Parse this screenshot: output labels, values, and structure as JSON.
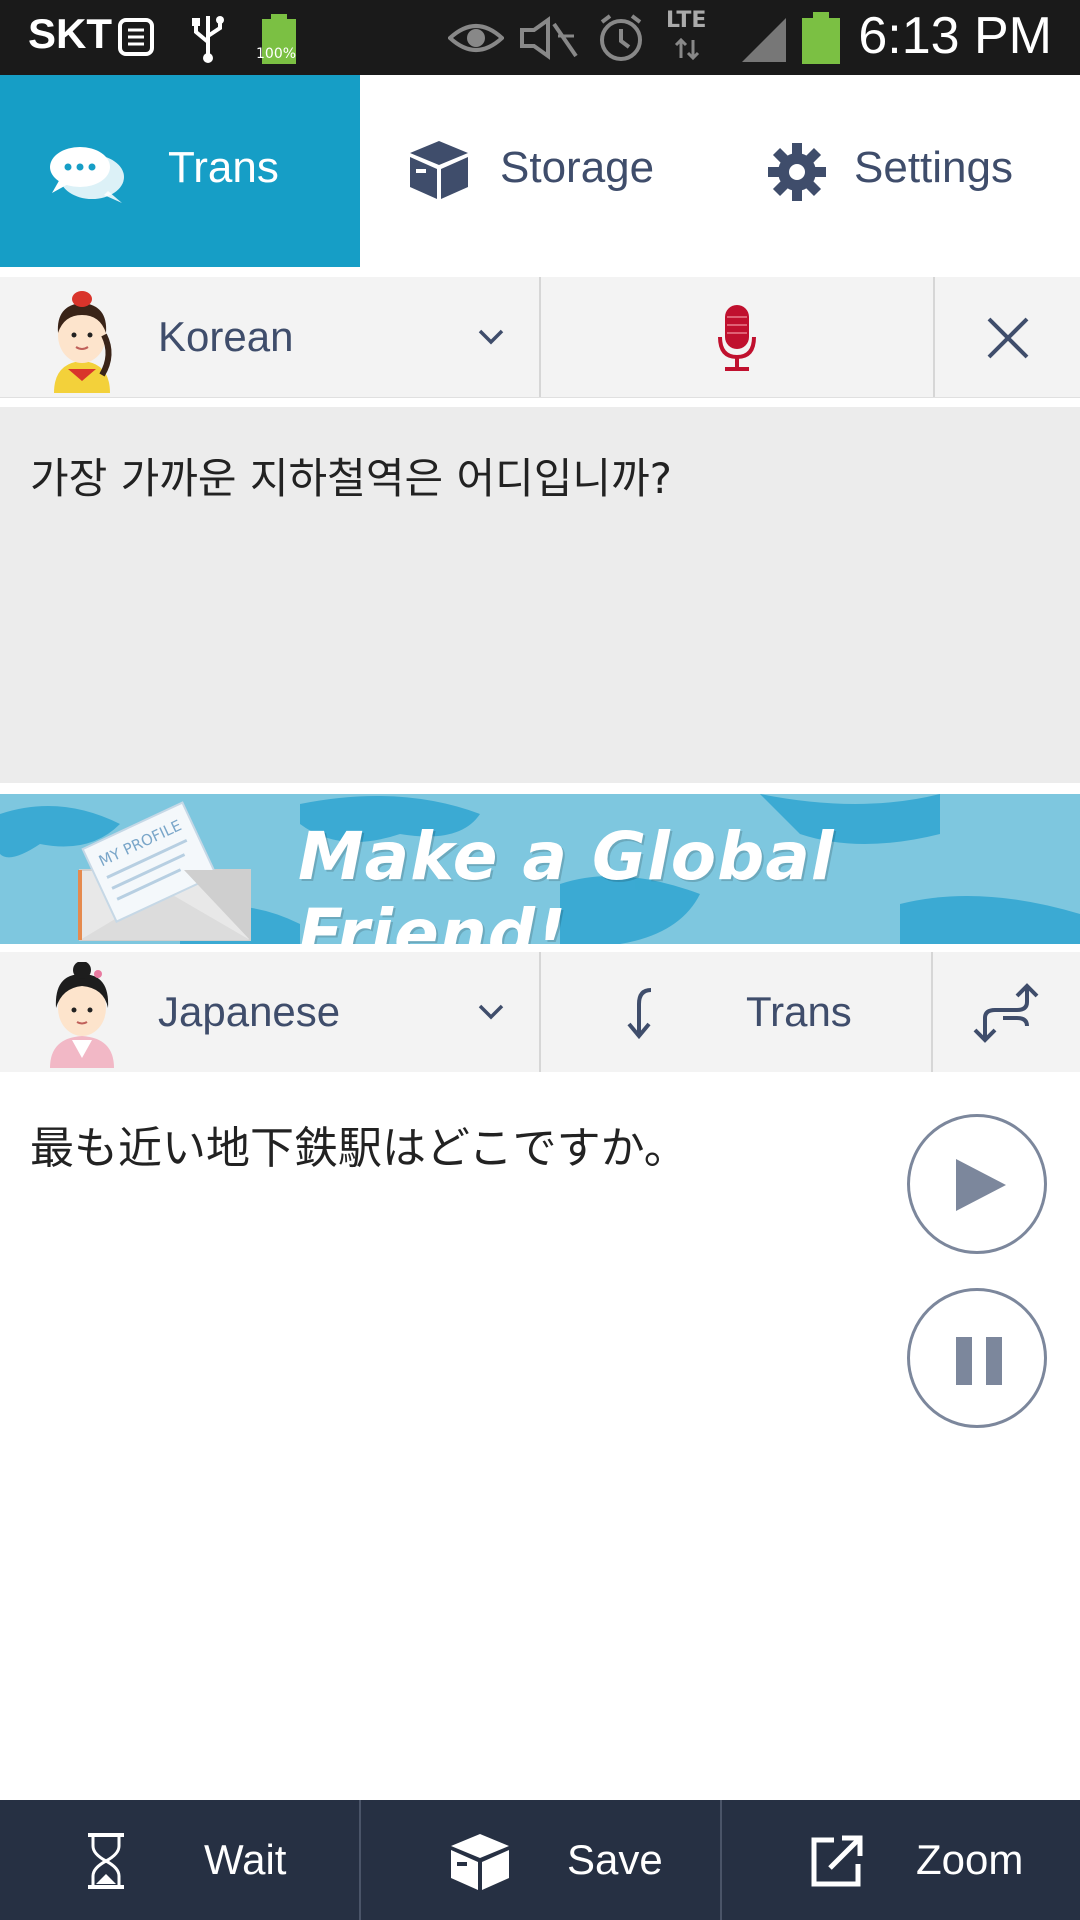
{
  "status_bar": {
    "carrier": "SKT",
    "battery_percent": "100%",
    "network": "LTE",
    "time": "6:13 PM",
    "icons": [
      "notes-icon",
      "usb-icon",
      "battery-icon",
      "eye-icon",
      "mute-icon",
      "alarm-icon",
      "signal-icon"
    ]
  },
  "tabs": [
    {
      "label": "Trans",
      "icon": "chat-bubbles-icon",
      "active": true
    },
    {
      "label": "Storage",
      "icon": "box-icon",
      "active": false
    },
    {
      "label": "Settings",
      "icon": "gear-icon",
      "active": false
    }
  ],
  "source": {
    "language": "Korean",
    "text": "가장 가까운 지하철역은 어디입니까?"
  },
  "banner": {
    "text": "Make a Global Friend!",
    "envelope_label": "MY PROFILE"
  },
  "target": {
    "language": "Japanese",
    "trans_label": "Trans",
    "text": "最も近い地下鉄駅はどこですか。"
  },
  "bottom_bar": {
    "wait_label": "Wait",
    "save_label": "Save",
    "zoom_label": "Zoom"
  },
  "colors": {
    "accent": "#169ec6",
    "navy": "#263043",
    "text": "#3f4d6b",
    "mic": "#c0102e"
  }
}
